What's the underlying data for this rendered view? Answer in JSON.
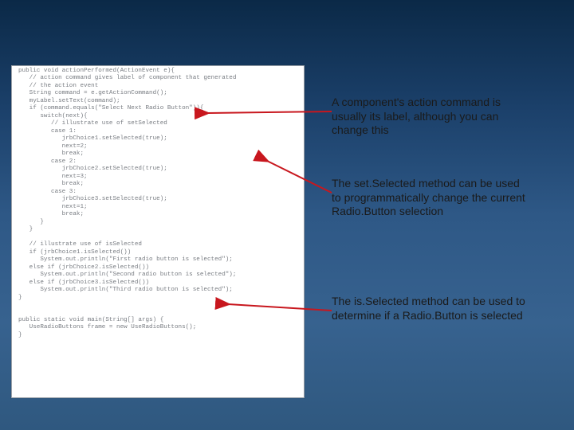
{
  "code": "public void actionPerformed(ActionEvent e){\n   // action command gives label of component that generated\n   // the action event\n   String command = e.getActionCommand();\n   myLabel.setText(command);\n   if (command.equals(\"Select Next Radio Button\")){\n      switch(next){\n         // illustrate use of setSelected\n         case 1:\n            jrbChoice1.setSelected(true);\n            next=2;\n            break;\n         case 2:\n            jrbChoice2.setSelected(true);\n            next=3;\n            break;\n         case 3:\n            jrbChoice3.setSelected(true);\n            next=1;\n            break;\n      }\n   }\n\n   // illustrate use of isSelected\n   if (jrbChoice1.isSelected())\n      System.out.println(\"First radio button is selected\");\n   else if (jrbChoice2.isSelected())\n      System.out.println(\"Second radio button is selected\");\n   else if (jrbChoice3.isSelected())\n      System.out.println(\"Third radio button is selected\");\n}\n\n\npublic static void main(String[] args) {\n   UseRadioButtons frame = new UseRadioButtons();\n}",
  "callouts": {
    "c1": "A component's action command is usually its label, although you can change this",
    "c2": "The set.Selected method can be used to programmatically change the current Radio.Button selection",
    "c3": "The is.Selected method can be used to determine if a Radio.Button is selected"
  },
  "colors": {
    "arrow": "#c8171e"
  }
}
